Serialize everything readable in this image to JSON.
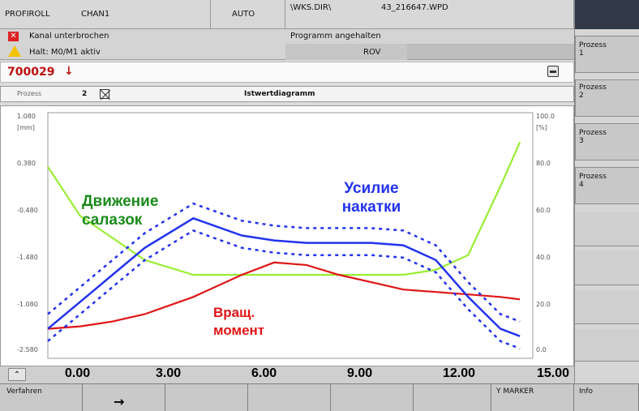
{
  "header": {
    "program_label": "PROFIROLL",
    "channel_label": "CHAN1",
    "mode": "AUTO",
    "path": "\\WKS.DIR\\",
    "file": "43_216647.WPD",
    "alarm1": "Kanal unterbrochen",
    "alarm2": "Halt: M0/M1 aktiv",
    "status1": "Programm angehalten",
    "status2": "ROV",
    "alarm_number": "700029",
    "alarm_arrow": "↓",
    "process_label": "Prozess",
    "process_number": "2",
    "chart_title": "Istwertdiagramm"
  },
  "right_softkeys": [
    "Prozess\n1",
    "Prozess\n2",
    "Prozess\n3",
    "Prozess\n4"
  ],
  "bottom_softkeys": [
    "Verfahren",
    "→",
    "",
    "",
    "",
    "",
    "Y MARKER",
    "Info"
  ],
  "chart": {
    "left_axis_ticks": [
      "1.080",
      "[mm]",
      "0.380",
      "-0.480",
      "-1.480",
      "-1.080",
      "-2.580"
    ],
    "right_axis_ticks": [
      "100.0",
      "[%]",
      "80.0",
      "60.0",
      "40.0",
      "20.0",
      "0.0"
    ],
    "x_ticks": [
      "0.00",
      "3.00",
      "6.00",
      "9.00",
      "12.00",
      "15.00"
    ],
    "annotations": {
      "slide_motion": "Движение\nсалазок",
      "rolling_force": "Усилие\nнакатки",
      "torque": "Вращ.\nмомент"
    },
    "colors": {
      "slide": "#99ee33",
      "force": "#2233ee",
      "torque": "#e01515",
      "label_slide": "#1a8a1a"
    }
  },
  "chart_data": {
    "type": "line",
    "x": [
      0,
      1,
      2,
      3,
      4.5,
      6,
      7,
      8,
      9,
      10,
      11,
      12,
      13,
      14,
      14.6
    ],
    "series": [
      {
        "name": "Движение салазок",
        "values": [
          78,
          58,
          49,
          40,
          34,
          34,
          34,
          34,
          34,
          34,
          34,
          36,
          42,
          70,
          88
        ]
      },
      {
        "name": "Усилие накатки",
        "values": [
          12,
          23,
          34,
          45,
          57,
          50,
          48,
          47,
          47,
          47,
          46,
          40,
          25,
          12,
          9
        ]
      },
      {
        "name": "Вращ. момент",
        "values": [
          12,
          13,
          15,
          18,
          25,
          34,
          39,
          38,
          34,
          31,
          28,
          27,
          26,
          25,
          24
        ]
      }
    ],
    "xlim": [
      0,
      15
    ],
    "ylim": [
      0,
      100
    ]
  }
}
